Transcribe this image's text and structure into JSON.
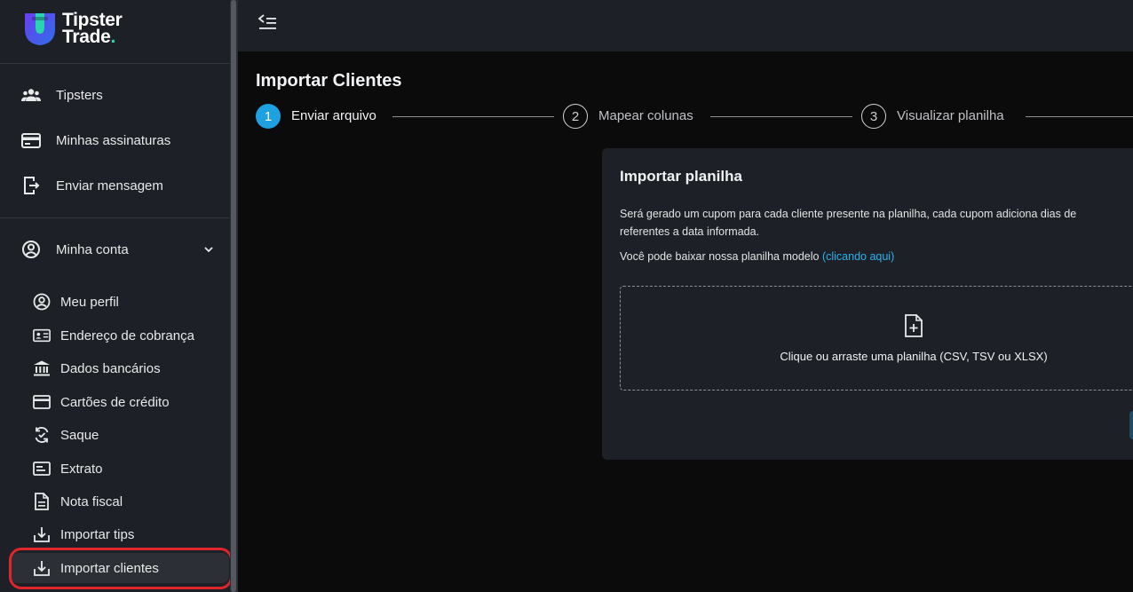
{
  "brand": {
    "line1": "Tipster",
    "line2": "Trade",
    "dot": ".",
    "accent": "#2ad4b3"
  },
  "sidebar": {
    "items": [
      {
        "label": "Tipsters",
        "icon": "users-icon"
      },
      {
        "label": "Minhas assinaturas",
        "icon": "credit-card-icon"
      },
      {
        "label": "Enviar mensagem",
        "icon": "send-message-icon"
      }
    ],
    "account": {
      "label": "Minha conta",
      "icon": "user-circle-icon",
      "expanded": true
    },
    "subitems": [
      {
        "label": "Meu perfil",
        "icon": "profile-icon"
      },
      {
        "label": "Endereço de cobrança",
        "icon": "id-card-icon"
      },
      {
        "label": "Dados bancários",
        "icon": "bank-icon"
      },
      {
        "label": "Cartões de crédito",
        "icon": "card-icon"
      },
      {
        "label": "Saque",
        "icon": "withdraw-icon"
      },
      {
        "label": "Extrato",
        "icon": "statement-icon"
      },
      {
        "label": "Nota fiscal",
        "icon": "invoice-icon"
      },
      {
        "label": "Importar tips",
        "icon": "import-icon"
      },
      {
        "label": "Importar clientes",
        "icon": "import-icon",
        "active": true
      }
    ]
  },
  "main": {
    "title": "Importar Clientes",
    "steps": [
      {
        "number": "1",
        "label": "Enviar arquivo",
        "active": true
      },
      {
        "number": "2",
        "label": "Mapear colunas",
        "active": false
      },
      {
        "number": "3",
        "label": "Visualizar planilha",
        "active": false
      }
    ],
    "card": {
      "title": "Importar planilha",
      "description_line1": "Será gerado um cupom para cada cliente presente na planilha, cada cupom adiciona dias de",
      "description_line2": "referentes a data informada.",
      "download_text": "Você pode baixar nossa planilha modelo",
      "download_link": "(clicando aqui)",
      "dropzone_hint": "Clique ou arraste uma planilha (CSV, TSV ou XLSX)"
    }
  },
  "colors": {
    "sidebar_bg": "#1d2026",
    "page_bg": "#0b0b0c",
    "step_active": "#1da1e0",
    "link": "#2ab4ef",
    "highlight": "#e0252b"
  }
}
